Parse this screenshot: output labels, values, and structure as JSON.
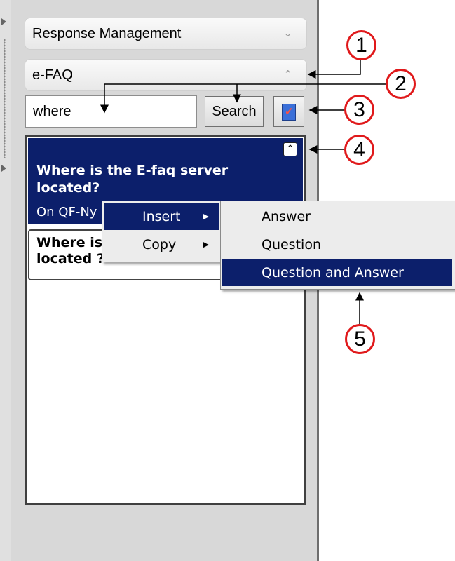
{
  "accordion": {
    "response_management": "Response Management",
    "efaq": "e-FAQ"
  },
  "search": {
    "value": "where",
    "button_label": "Search"
  },
  "results": {
    "selected": {
      "question": "Where is the E-faq server located?",
      "answer_partial": "On QF-Ny"
    },
    "item": {
      "question_partial": "Where is\nlocated ?"
    }
  },
  "context_menu": {
    "items": [
      "Insert",
      "Copy"
    ],
    "highlighted": "Insert"
  },
  "submenu": {
    "items": [
      "Answer",
      "Question",
      "Question and Answer"
    ],
    "highlighted": "Question and Answer"
  },
  "callouts": [
    "1",
    "2",
    "3",
    "4",
    "5"
  ],
  "colors": {
    "selection": "#0c1f6b",
    "callout_border": "#e0191b"
  }
}
